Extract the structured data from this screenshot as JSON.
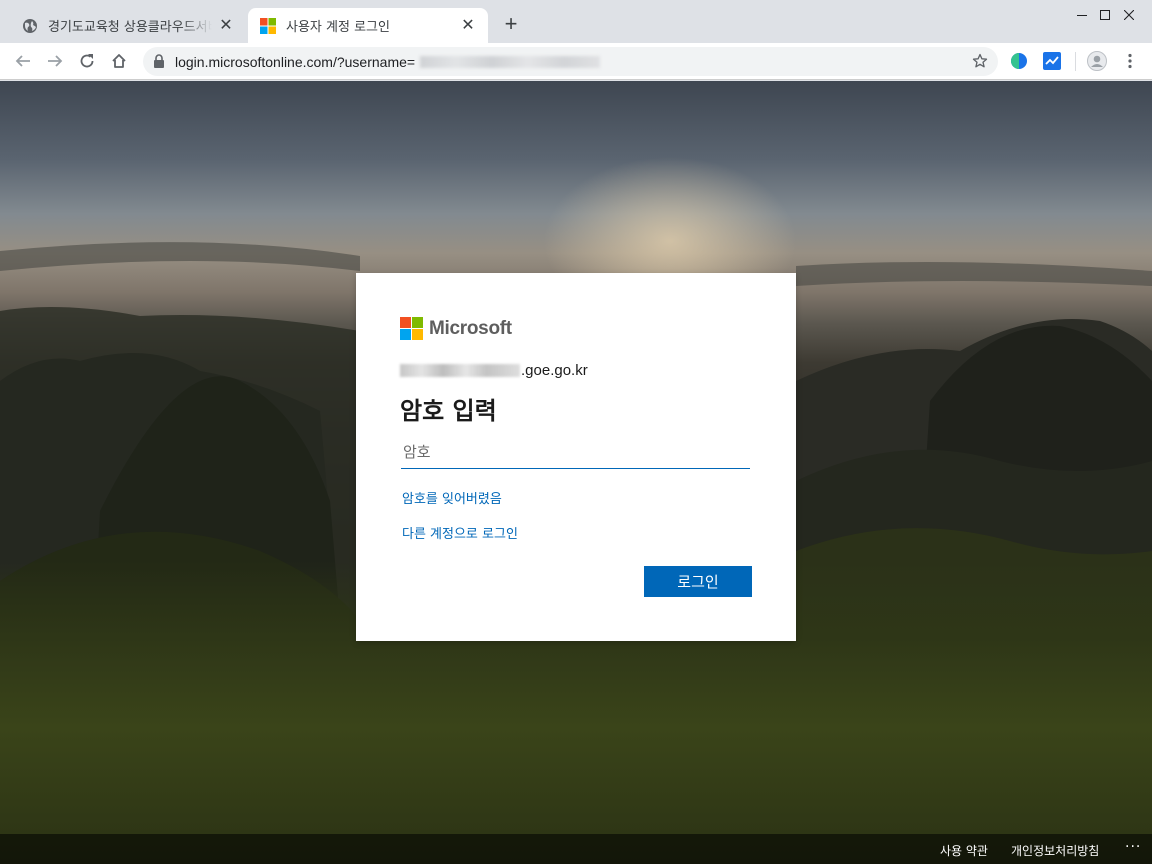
{
  "browser": {
    "tabs": [
      {
        "title": "경기도교육청 상용클라우드서비스",
        "favicon": "globe-icon",
        "active": false
      },
      {
        "title": "사용자 계정 로그인",
        "favicon": "microsoft-logo-icon",
        "active": true
      }
    ],
    "address_bar": {
      "url_visible": "login.microsoftonline.com/?username="
    }
  },
  "login": {
    "brand": "Microsoft",
    "identity_domain": ".goe.go.kr",
    "heading": "암호 입력",
    "password_placeholder": "암호",
    "password_value": "",
    "forgot_link": "암호를 잊어버렸음",
    "other_account_link": "다른 계정으로 로그인",
    "submit_label": "로그인"
  },
  "footer": {
    "terms": "사용 약관",
    "privacy": "개인정보처리방침",
    "more": "···"
  },
  "colors": {
    "accent": "#0067b8",
    "ms_red": "#f25022",
    "ms_green": "#7fba00",
    "ms_blue": "#00a4ef",
    "ms_yellow": "#ffb900"
  }
}
